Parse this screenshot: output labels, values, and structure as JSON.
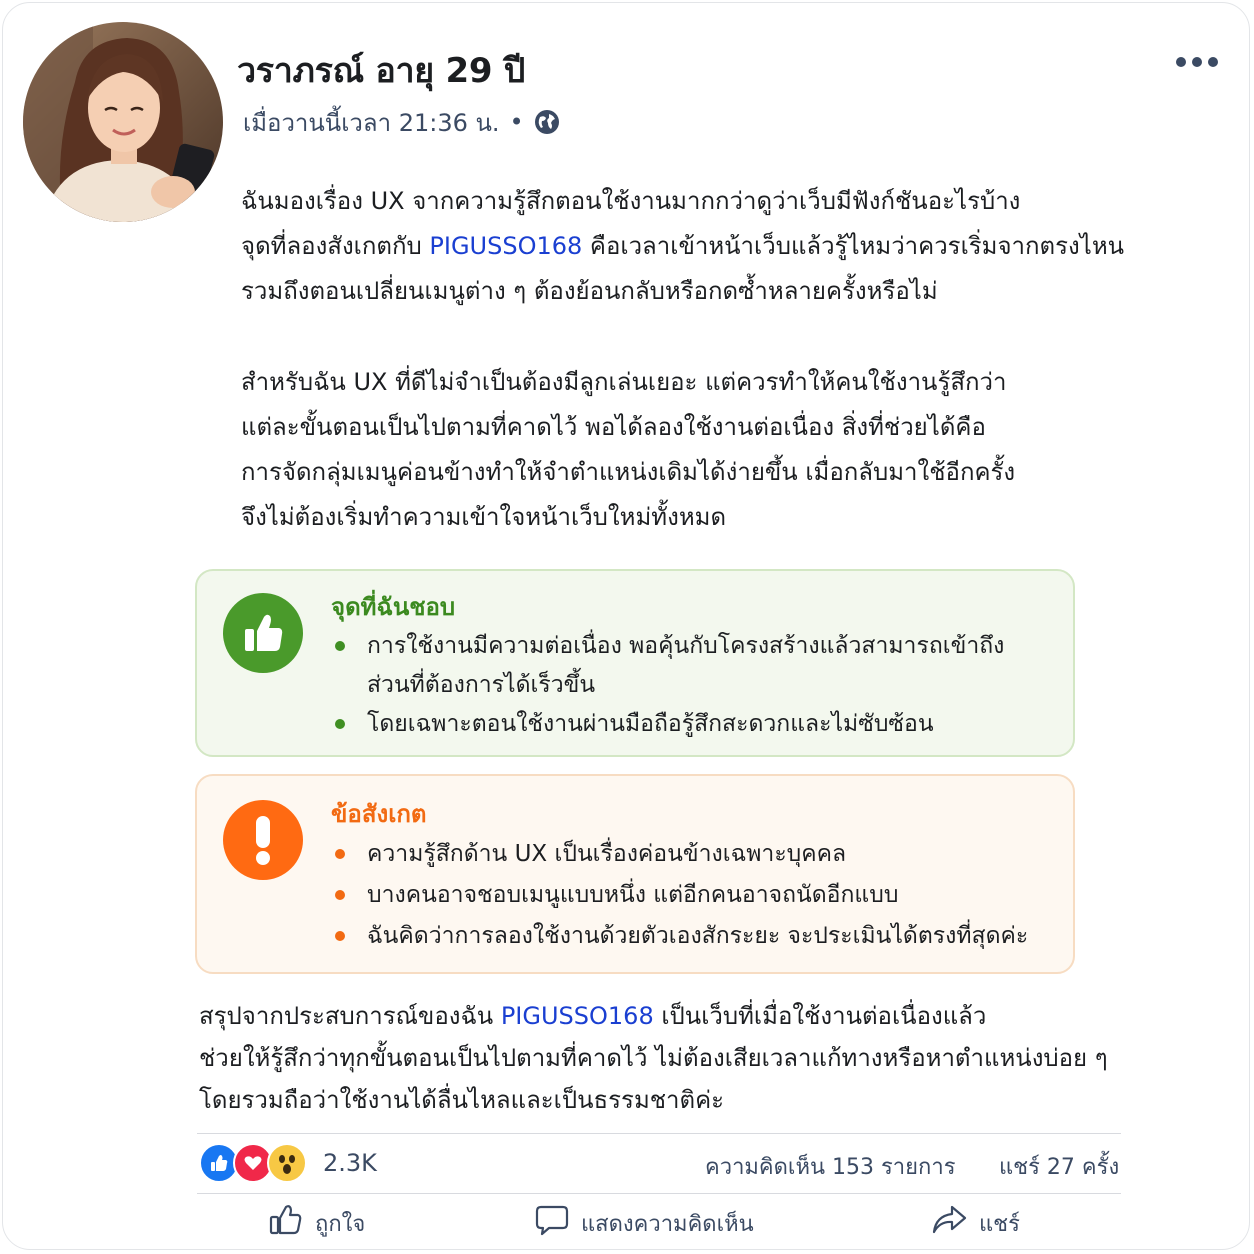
{
  "post": {
    "author": "วราภรณ์ อายุ 29 ปี",
    "timestamp": "เมื่อวานนี้เวลา 21:36 น.",
    "separator": "•",
    "privacy_icon": "globe-icon",
    "more_icon": "more-dots-icon",
    "paragraph1": {
      "line1": "ฉันมองเรื่อง UX จากความรู้สึกตอนใช้งานมากกว่าดูว่าเว็บมีฟังก์ชันอะไรบ้าง",
      "line2_pre": "จุดที่ลองสังเกตกับ ",
      "link": "PIGUSSO168",
      "line2_post": " คือเวลาเข้าหน้าเว็บแล้วรู้ไหมว่าควรเริ่มจากตรงไหน",
      "line3": "รวมถึงตอนเปลี่ยนเมนูต่าง ๆ ต้องย้อนกลับหรือกดซ้ำหลายครั้งหรือไม่"
    },
    "paragraph2": {
      "line1": "สำหรับฉัน UX ที่ดีไม่จำเป็นต้องมีลูกเล่นเยอะ แต่ควรทำให้คนใช้งานรู้สึกว่า",
      "line2": "แต่ละขั้นตอนเป็นไปตามที่คาดไว้ พอได้ลองใช้งานต่อเนื่อง สิ่งที่ช่วยได้คือ",
      "line3": "การจัดกลุ่มเมนูค่อนข้างทำให้จำตำแหน่งเดิมได้ง่ายขึ้น เมื่อกลับมาใช้อีกครั้ง",
      "line4": "จึงไม่ต้องเริ่มทำความเข้าใจหน้าเว็บใหม่ทั้งหมด"
    },
    "likes_box": {
      "title": "จุดที่ฉันชอบ",
      "icon": "thumbs-up-icon",
      "color": "#4a9a2b",
      "items": [
        {
          "line1": "การใช้งานมีความต่อเนื่อง พอคุ้นกับโครงสร้างแล้วสามารถเข้าถึง",
          "line2": "ส่วนที่ต้องการได้เร็วขึ้น"
        },
        {
          "line1": "โดยเฉพาะตอนใช้งานผ่านมือถือรู้สึกสะดวกและไม่ซับซ้อน",
          "line2": ""
        }
      ]
    },
    "notes_box": {
      "title": "ข้อสังเกต",
      "icon": "exclamation-icon",
      "color": "#ff6a12",
      "items": [
        "ความรู้สึกด้าน UX เป็นเรื่องค่อนข้างเฉพาะบุคคล",
        "บางคนอาจชอบเมนูแบบหนึ่ง แต่อีกคนอาจถนัดอีกแบบ",
        "ฉันคิดว่าการลองใช้งานด้วยตัวเองสักระยะ จะประเมินได้ตรงที่สุดค่ะ"
      ]
    },
    "paragraph3": {
      "line1_pre": "สรุปจากประสบการณ์ของฉัน ",
      "link": "PIGUSSO168",
      "line1_post": " เป็นเว็บที่เมื่อใช้งานต่อเนื่องแล้ว",
      "line2": "ช่วยให้รู้สึกว่าทุกขั้นตอนเป็นไปตามที่คาดไว้ ไม่ต้องเสียเวลาแก้ทางหรือหาตำแหน่งบ่อย ๆ",
      "line3": "โดยรวมถือว่าใช้งานได้ลื่นไหลและเป็นธรรมชาติค่ะ"
    }
  },
  "stats": {
    "reaction_icons": [
      "like-reaction-icon",
      "love-reaction-icon",
      "wow-reaction-icon"
    ],
    "reaction_count": "2.3K",
    "comments": "ความคิดเห็น 153 รายการ",
    "shares": "แชร์ 27 ครั้ง"
  },
  "actions": {
    "like": "ถูกใจ",
    "comment": "แสดงความคิดเห็น",
    "share": "แชร์"
  },
  "colors": {
    "link": "#1a3fd1",
    "like_blue": "#1877f2",
    "love_red": "#f02849",
    "wow_yellow": "#f7c844",
    "success_green": "#4a9a2b",
    "warning_orange": "#ff6a12"
  }
}
